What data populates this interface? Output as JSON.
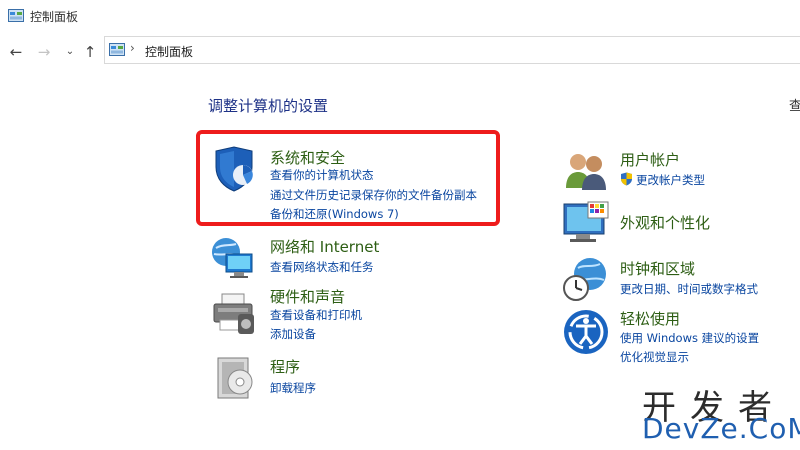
{
  "window": {
    "title": "控制面板"
  },
  "nav": {
    "back_icon": "back-arrow-icon",
    "forward_icon": "forward-arrow-icon",
    "recent_icon": "chevron-down-icon",
    "up_icon": "up-arrow-icon",
    "separator": "›",
    "breadcrumb": "控制面板"
  },
  "main": {
    "heading": "调整计算机的设置",
    "view_by_fragment": "查",
    "categories": [
      {
        "title": "系统和安全",
        "links": [
          "查看你的计算机状态",
          "通过文件历史记录保存你的文件备份副本",
          "备份和还原(Windows 7)"
        ]
      },
      {
        "title": "网络和 Internet",
        "links": [
          "查看网络状态和任务"
        ]
      },
      {
        "title": "硬件和声音",
        "links": [
          "查看设备和打印机",
          "添加设备"
        ]
      },
      {
        "title": "程序",
        "links": [
          "卸载程序"
        ]
      },
      {
        "title": "用户帐户",
        "links": [
          "更改帐户类型"
        ]
      },
      {
        "title": "外观和个性化",
        "links": []
      },
      {
        "title": "时钟和区域",
        "links": [
          "更改日期、时间或数字格式"
        ]
      },
      {
        "title": "轻松使用",
        "links": [
          "使用 Windows 建议的设置",
          "优化视觉显示"
        ]
      }
    ]
  },
  "colors": {
    "highlight_border": "#ee1c1c",
    "category_title": "#2d5e14",
    "link": "#0a46a0",
    "heading": "#1e3287"
  },
  "watermark": {
    "top": "开发者",
    "bottom": "DevZe.CoM"
  }
}
